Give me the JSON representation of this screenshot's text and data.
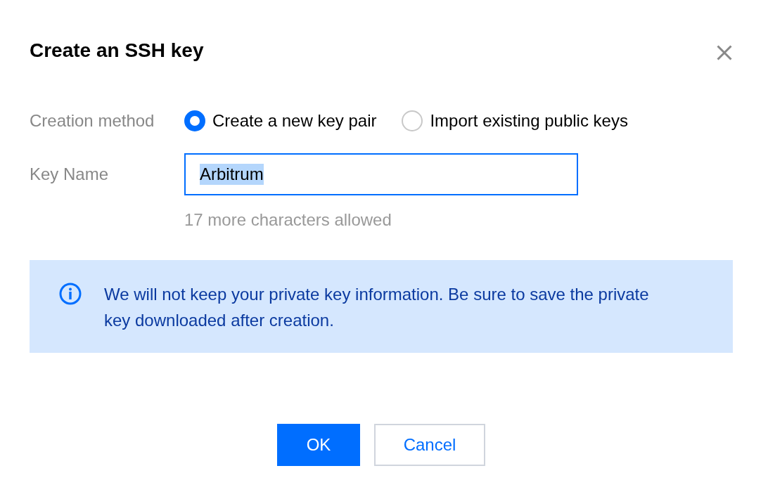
{
  "dialog": {
    "title": "Create an SSH key"
  },
  "form": {
    "creation_method": {
      "label": "Creation method",
      "options": [
        {
          "label": "Create a new key pair",
          "selected": true
        },
        {
          "label": "Import existing public keys",
          "selected": false
        }
      ]
    },
    "key_name": {
      "label": "Key Name",
      "value": "Arbitrum",
      "focused": true,
      "text_selected": true,
      "hint": "17 more characters allowed"
    }
  },
  "notice": {
    "text": "We will not keep your private key information. Be sure to save the private key downloaded after creation."
  },
  "buttons": [
    {
      "label": "OK",
      "kind": "primary"
    },
    {
      "label": "Cancel",
      "kind": "secondary"
    }
  ]
}
